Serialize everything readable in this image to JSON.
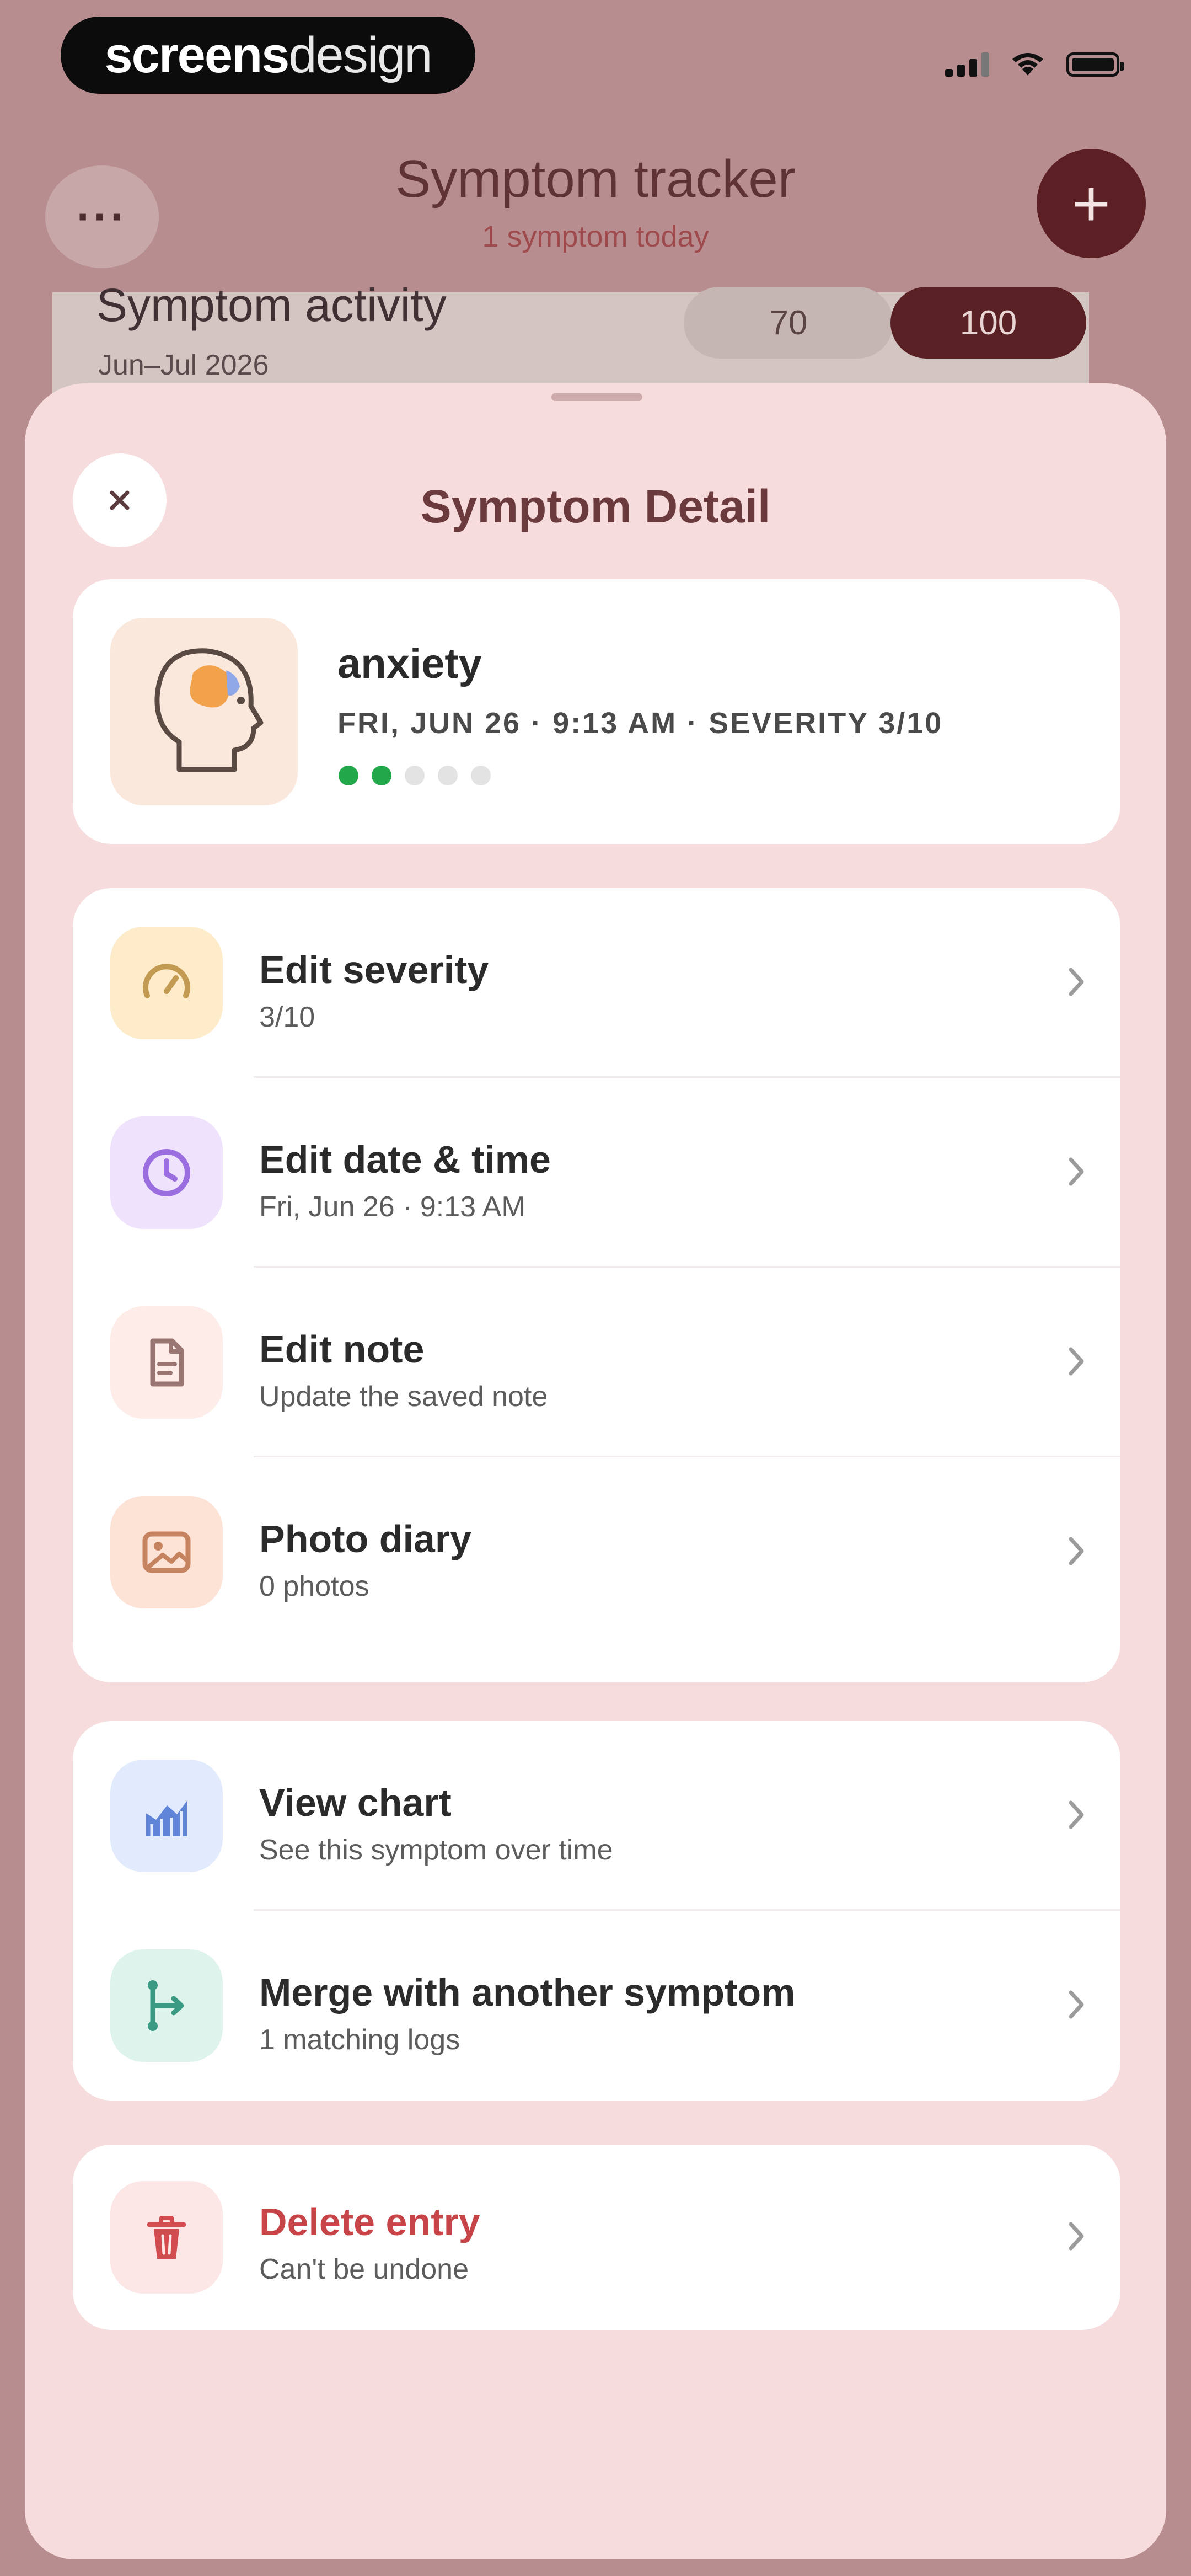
{
  "status_bar": {
    "brand_bold": "screens",
    "brand_thin": "design"
  },
  "header": {
    "more_label": "···",
    "title": "Symptom tracker",
    "subtitle": "1 symptom today",
    "add_label": "+"
  },
  "activity_card": {
    "title": "Symptom activity",
    "subtitle": "Jun–Jul 2026",
    "segments": [
      "70",
      "100"
    ],
    "selected_segment": "100"
  },
  "sheet": {
    "title": "Symptom Detail",
    "summary": {
      "icon": "head-brain-icon",
      "name": "anxiety",
      "meta": "FRI, JUN 26 · 9:13 AM · SEVERITY 3/10",
      "severity_dots_filled": 2,
      "severity_dots_total": 5
    },
    "edit_group": [
      {
        "icon": "gauge-icon",
        "label": "Edit severity",
        "sublabel": "3/10",
        "tile_color": "#fdebc9",
        "icon_color": "#c39a52"
      },
      {
        "icon": "clock-icon",
        "label": "Edit date & time",
        "sublabel": "Fri, Jun 26 · 9:13 AM",
        "tile_color": "#efe2fd",
        "icon_color": "#9b6ee0"
      },
      {
        "icon": "document-icon",
        "label": "Edit note",
        "sublabel": "Update the saved note",
        "tile_color": "#fdece8",
        "icon_color": "#9a7672"
      },
      {
        "icon": "photo-icon",
        "label": "Photo diary",
        "sublabel": "0 photos",
        "tile_color": "#fde2d6",
        "icon_color": "#c6835f"
      }
    ],
    "insight_group": [
      {
        "icon": "chart-icon",
        "label": "View chart",
        "sublabel": "See this symptom over time",
        "tile_color": "#e2ebfd",
        "icon_color": "#5f84d8"
      },
      {
        "icon": "merge-icon",
        "label": "Merge with another symptom",
        "sublabel": "1 matching logs",
        "tile_color": "#dff3ed",
        "icon_color": "#3b9a83"
      }
    ],
    "danger_group": [
      {
        "icon": "trash-icon",
        "label": "Delete entry",
        "sublabel": "Can't be undone",
        "tile_color": "#fde6e6",
        "icon_color": "#d24b4f"
      }
    ]
  }
}
